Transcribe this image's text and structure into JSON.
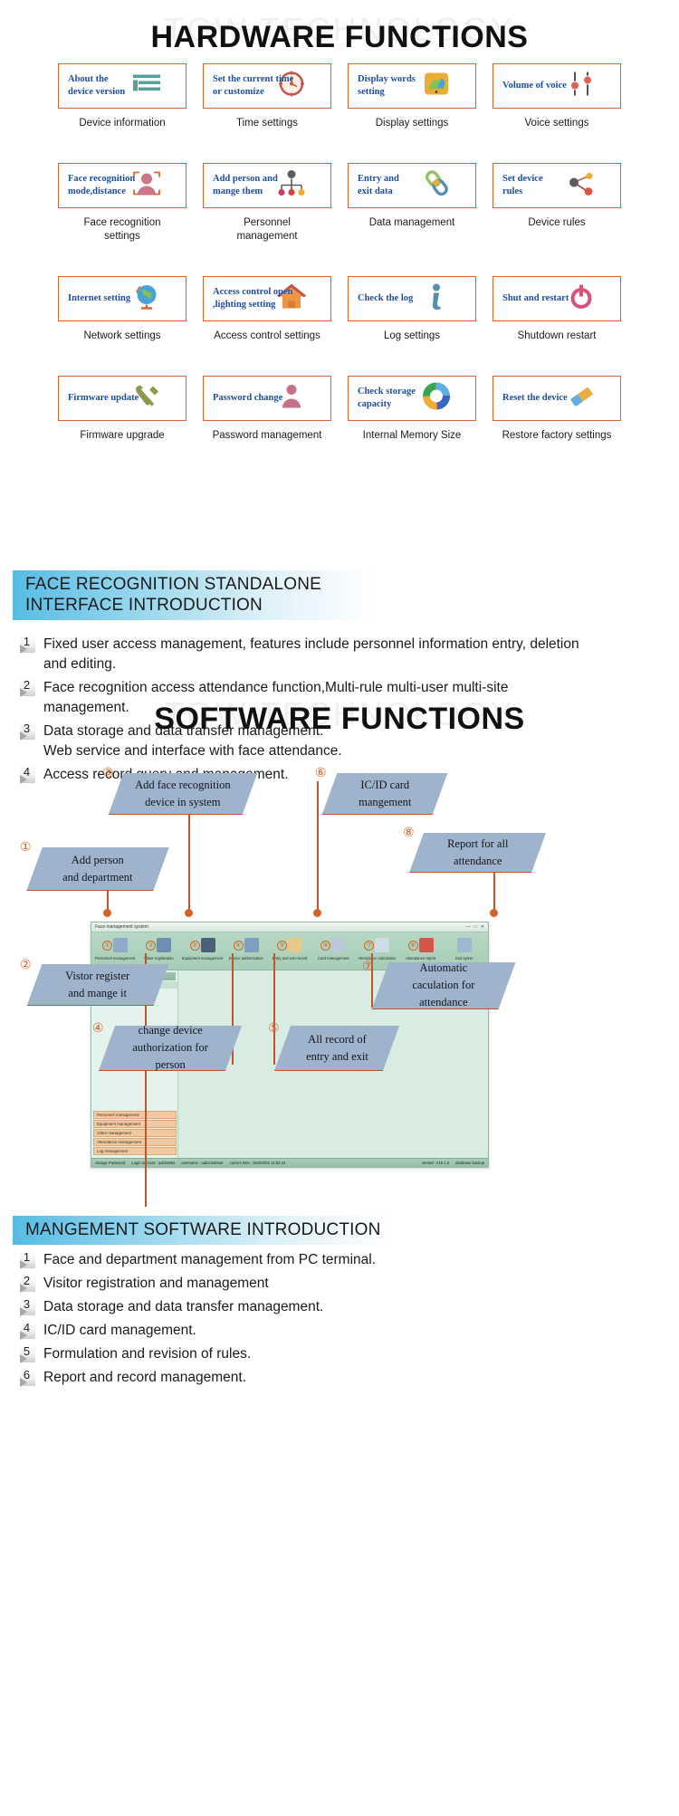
{
  "watermarks": {
    "text": "TGW TECHNOLOGY"
  },
  "hardware": {
    "title": "HARDWARE FUNCTIONS",
    "items": [
      {
        "box_label": "About the\ndevice version",
        "caption": "Device information",
        "icon": "list-lines-icon"
      },
      {
        "box_label": "Set the current time\nor customize",
        "caption": "Time settings",
        "icon": "clock-icon"
      },
      {
        "box_label": "Display words\nsetting",
        "caption": "Display settings",
        "icon": "monitor-icon"
      },
      {
        "box_label": "Volume of voice",
        "caption": "Voice settings",
        "icon": "sliders-icon"
      },
      {
        "box_label": "Face recognition\nmode,distance",
        "caption": "Face recognition\nsettings",
        "icon": "face-scan-icon"
      },
      {
        "box_label": "Add person and\nmange them",
        "caption": "Personnel\nmanagement",
        "icon": "org-chart-icon"
      },
      {
        "box_label": "Entry and\nexit data",
        "caption": "Data management",
        "icon": "chain-link-icon"
      },
      {
        "box_label": "Set device\nrules",
        "caption": "Device rules",
        "icon": "nodes-icon"
      },
      {
        "box_label": "Internet  setting",
        "caption": "Network settings",
        "icon": "globe-icon"
      },
      {
        "box_label": "Access control open\n,lighting  setting",
        "caption": "Access control settings",
        "icon": "house-icon"
      },
      {
        "box_label": "Check the log",
        "caption": "Log settings",
        "icon": "info-icon"
      },
      {
        "box_label": "Shut and restart",
        "caption": "Shutdown restart",
        "icon": "power-icon"
      },
      {
        "box_label": "Firmware update",
        "caption": "Firmware upgrade",
        "icon": "wrench-screwdriver-icon"
      },
      {
        "box_label": "Password change",
        "caption": "Password management",
        "icon": "person-icon"
      },
      {
        "box_label": "Check storage\ncapacity",
        "caption": "Internal Memory Size",
        "icon": "donut-chart-icon"
      },
      {
        "box_label": "Reset the device",
        "caption": "Restore factory settings",
        "icon": "eraser-icon"
      }
    ]
  },
  "face_section": {
    "heading_line1": "FACE RECOGNITION STANDALONE",
    "heading_line2": "INTERFACE INTRODUCTION",
    "items": [
      {
        "n": "1",
        "text": "Fixed user access management, features include personnel information entry, deletion and editing."
      },
      {
        "n": "2",
        "text": "Face recognition access attendance function,Multi-rule multi-user multi-site management."
      },
      {
        "n": "3",
        "text": "Data storage and data transfer management.\nWeb service and interface with face attendance."
      },
      {
        "n": "4",
        "text": "Access record query and management."
      }
    ]
  },
  "software": {
    "title": "SOFTWARE FUNCTIONS",
    "callouts": [
      {
        "n": "①",
        "text": "Add person\nand department"
      },
      {
        "n": "②",
        "text": "Vistor register\nand mange it"
      },
      {
        "n": "③",
        "text": "Add face recognition\ndevice  in system"
      },
      {
        "n": "④",
        "text": "change  device\nauthorization for\nperson"
      },
      {
        "n": "⑤",
        "text": "All record of\nentry and exit"
      },
      {
        "n": "⑥",
        "text": "IC/ID card\nmangement"
      },
      {
        "n": "⑦",
        "text": "Automatic\ncaculation for\nattendance"
      },
      {
        "n": "⑧",
        "text": "Report for all\nattendance"
      }
    ],
    "window": {
      "title": "Face management system",
      "window_buttons": [
        "—",
        "□",
        "✕"
      ],
      "toolbar": [
        {
          "n": "①",
          "label": "Personnel management",
          "icon": "person-card-icon",
          "color": "#8fa9c6"
        },
        {
          "n": "②",
          "label": "Vistor registration",
          "icon": "visitor-icon",
          "color": "#6f8fb0"
        },
        {
          "n": "③",
          "label": "Equipment management",
          "icon": "face-device-icon",
          "color": "#4a6178"
        },
        {
          "n": "④",
          "label": "Device authorization",
          "icon": "auth-person-icon",
          "color": "#7ea0c0"
        },
        {
          "n": "⑤",
          "label": "Entry and exit record",
          "icon": "pencil-record-icon",
          "color": "#e4c98a"
        },
        {
          "n": "⑥",
          "label": "Card management",
          "icon": "card-reader-icon",
          "color": "#b9c9d8"
        },
        {
          "n": "⑦",
          "label": "Attendance calculation",
          "icon": "documents-icon",
          "color": "#cfdce8"
        },
        {
          "n": "⑧",
          "label": "Attendance report",
          "icon": "report-book-icon",
          "color": "#d4564a"
        },
        {
          "n": "",
          "label": "Exit sytem",
          "icon": "exit-icon",
          "color": "#9fb8cf"
        }
      ],
      "sidebar_header": "Functional module",
      "sidebar_items": [
        "Personnel management",
        "Department management",
        "+  Personnel management"
      ],
      "sidebar_bottom": [
        "Personnel management",
        "Equipment management",
        "Vistor management",
        "Attendance management",
        "Log management"
      ],
      "status_bar": {
        "change_password": "change Password",
        "login_account": "Login account : admin884",
        "username": "username : administrator",
        "current_time": "current time : 2019/3/25 14:52:43",
        "version": "version :V19.1.6",
        "backup": "database backup"
      }
    }
  },
  "mgmt_section": {
    "heading": "MANGEMENT SOFTWARE INTRODUCTION",
    "items": [
      {
        "n": "1",
        "text": "Face and department management from PC terminal."
      },
      {
        "n": "2",
        "text": "Visitor registration and management"
      },
      {
        "n": "3",
        "text": "Data storage and data transfer management."
      },
      {
        "n": "4",
        "text": "IC/ID card management."
      },
      {
        "n": "5",
        "text": "Formulation and revision of rules."
      },
      {
        "n": "6",
        "text": "Report and record management."
      }
    ]
  },
  "colors": {
    "box_border": "#d2642a",
    "box_text": "#1f4e9c",
    "heading_blue": "#56bce4",
    "callout_fill": "#9fb3cc",
    "leader": "#c0552b"
  }
}
